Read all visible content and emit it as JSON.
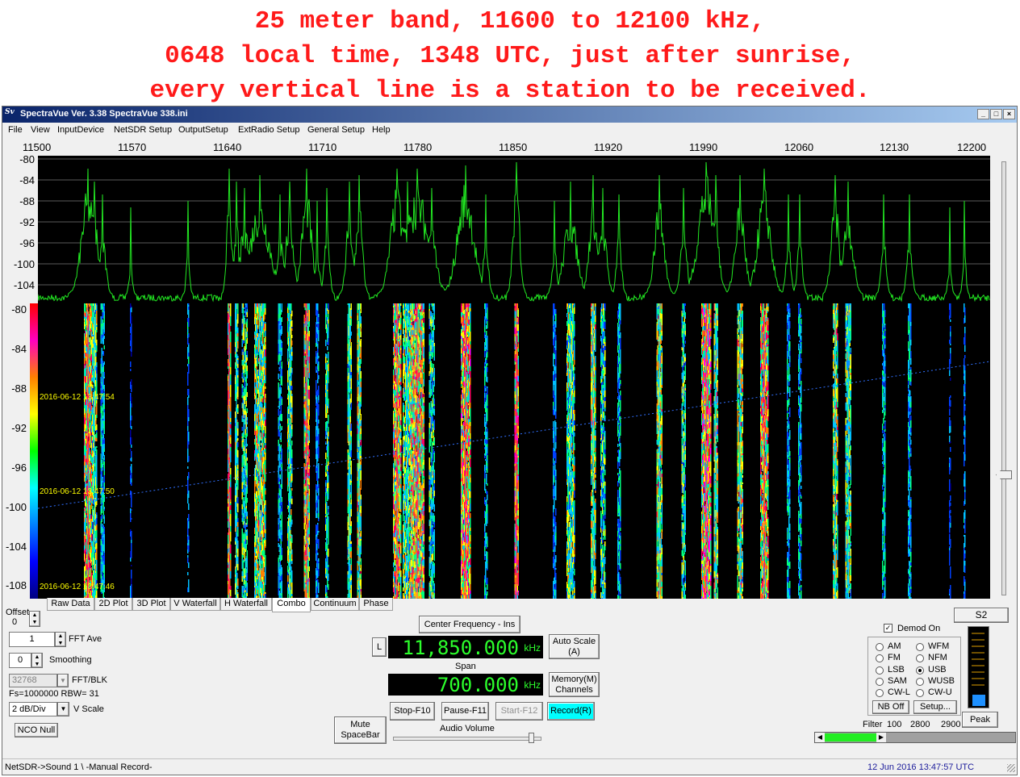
{
  "caption": {
    "line1": "25 meter band, 11600 to 12100 kHz,",
    "line2": "0648 local time, 1348 UTC, just after sunrise,",
    "line3": "every vertical line is a station to be received."
  },
  "window": {
    "title": "SpectraVue Ver. 3.38  SpectraVue 338.ini",
    "icon": "Sv"
  },
  "menu": [
    "File",
    "View",
    "InputDevice",
    "NetSDR Setup",
    "OutputSetup",
    "ExtRadio Setup",
    "General Setup",
    "Help"
  ],
  "freq_axis": [
    "11500",
    "11570",
    "11640",
    "11710",
    "11780",
    "11850",
    "11920",
    "11990",
    "12060",
    "12130",
    "12200"
  ],
  "spectrum_axis": [
    "-80",
    "-84",
    "-88",
    "-92",
    "-96",
    "-100",
    "-104"
  ],
  "waterfall_axis": [
    "-80",
    "-84",
    "-88",
    "-92",
    "-96",
    "-100",
    "-104",
    "-108"
  ],
  "timestamps": [
    "2016-06-12 13:47:54",
    "2016-06-12 13:47:50",
    "2016-06-12 13:47:46"
  ],
  "tabs": [
    "Raw Data",
    "2D Plot",
    "3D Plot",
    "V Waterfall",
    "H Waterfall",
    "Combo",
    "Continuum",
    "Phase"
  ],
  "active_tab": "Combo",
  "left_panel": {
    "offset_label": "Offset",
    "offset_value": "0",
    "fft_ave_value": "1",
    "fft_ave_label": "FFT Ave",
    "smoothing_value": "0",
    "smoothing_label": "Smoothing",
    "fft_blk_value": "32768",
    "fft_blk_label": "FFT/BLK",
    "fs_info": "Fs=1000000 RBW= 31",
    "vscale_value": "2 dB/Div",
    "vscale_label": "V Scale",
    "nco_null": "NCO Null"
  },
  "center": {
    "center_freq_button": "Center Frequency - Ins",
    "l_button": "L",
    "freq_value": "11,850.000",
    "freq_unit": "kHz",
    "span_label": "Span",
    "span_value": "700.000",
    "span_unit": "kHz",
    "auto_scale_1": "Auto Scale",
    "auto_scale_2": "(A)",
    "memory_1": "Memory(M)",
    "memory_2": "Channels",
    "stop": "Stop-F10",
    "pause": "Pause-F11",
    "start": "Start-F12",
    "record": "Record(R)",
    "mute_1": "Mute",
    "mute_2": "SpaceBar",
    "audio_volume": "Audio Volume"
  },
  "demod": {
    "s_meter": "S2",
    "demod_on": "Demod On",
    "modes_left": [
      "AM",
      "FM",
      "LSB",
      "SAM",
      "CW-L"
    ],
    "modes_right": [
      "WFM",
      "NFM",
      "USB",
      "WUSB",
      "CW-U"
    ],
    "selected": "USB",
    "nb_off": "NB Off",
    "setup": "Setup...",
    "peak": "Peak",
    "filter_label": "Filter",
    "filter_values": [
      "100",
      "2800",
      "2900"
    ]
  },
  "status": {
    "left": "NetSDR->Sound 1  \\ -Manual Record-",
    "right": "12 Jun 2016  13:47:57 UTC"
  },
  "colors": {
    "trace": "#22e822",
    "lcd_text": "#2cff2c",
    "record_button": "#00ffff",
    "caption": "#ff1a1a"
  }
}
